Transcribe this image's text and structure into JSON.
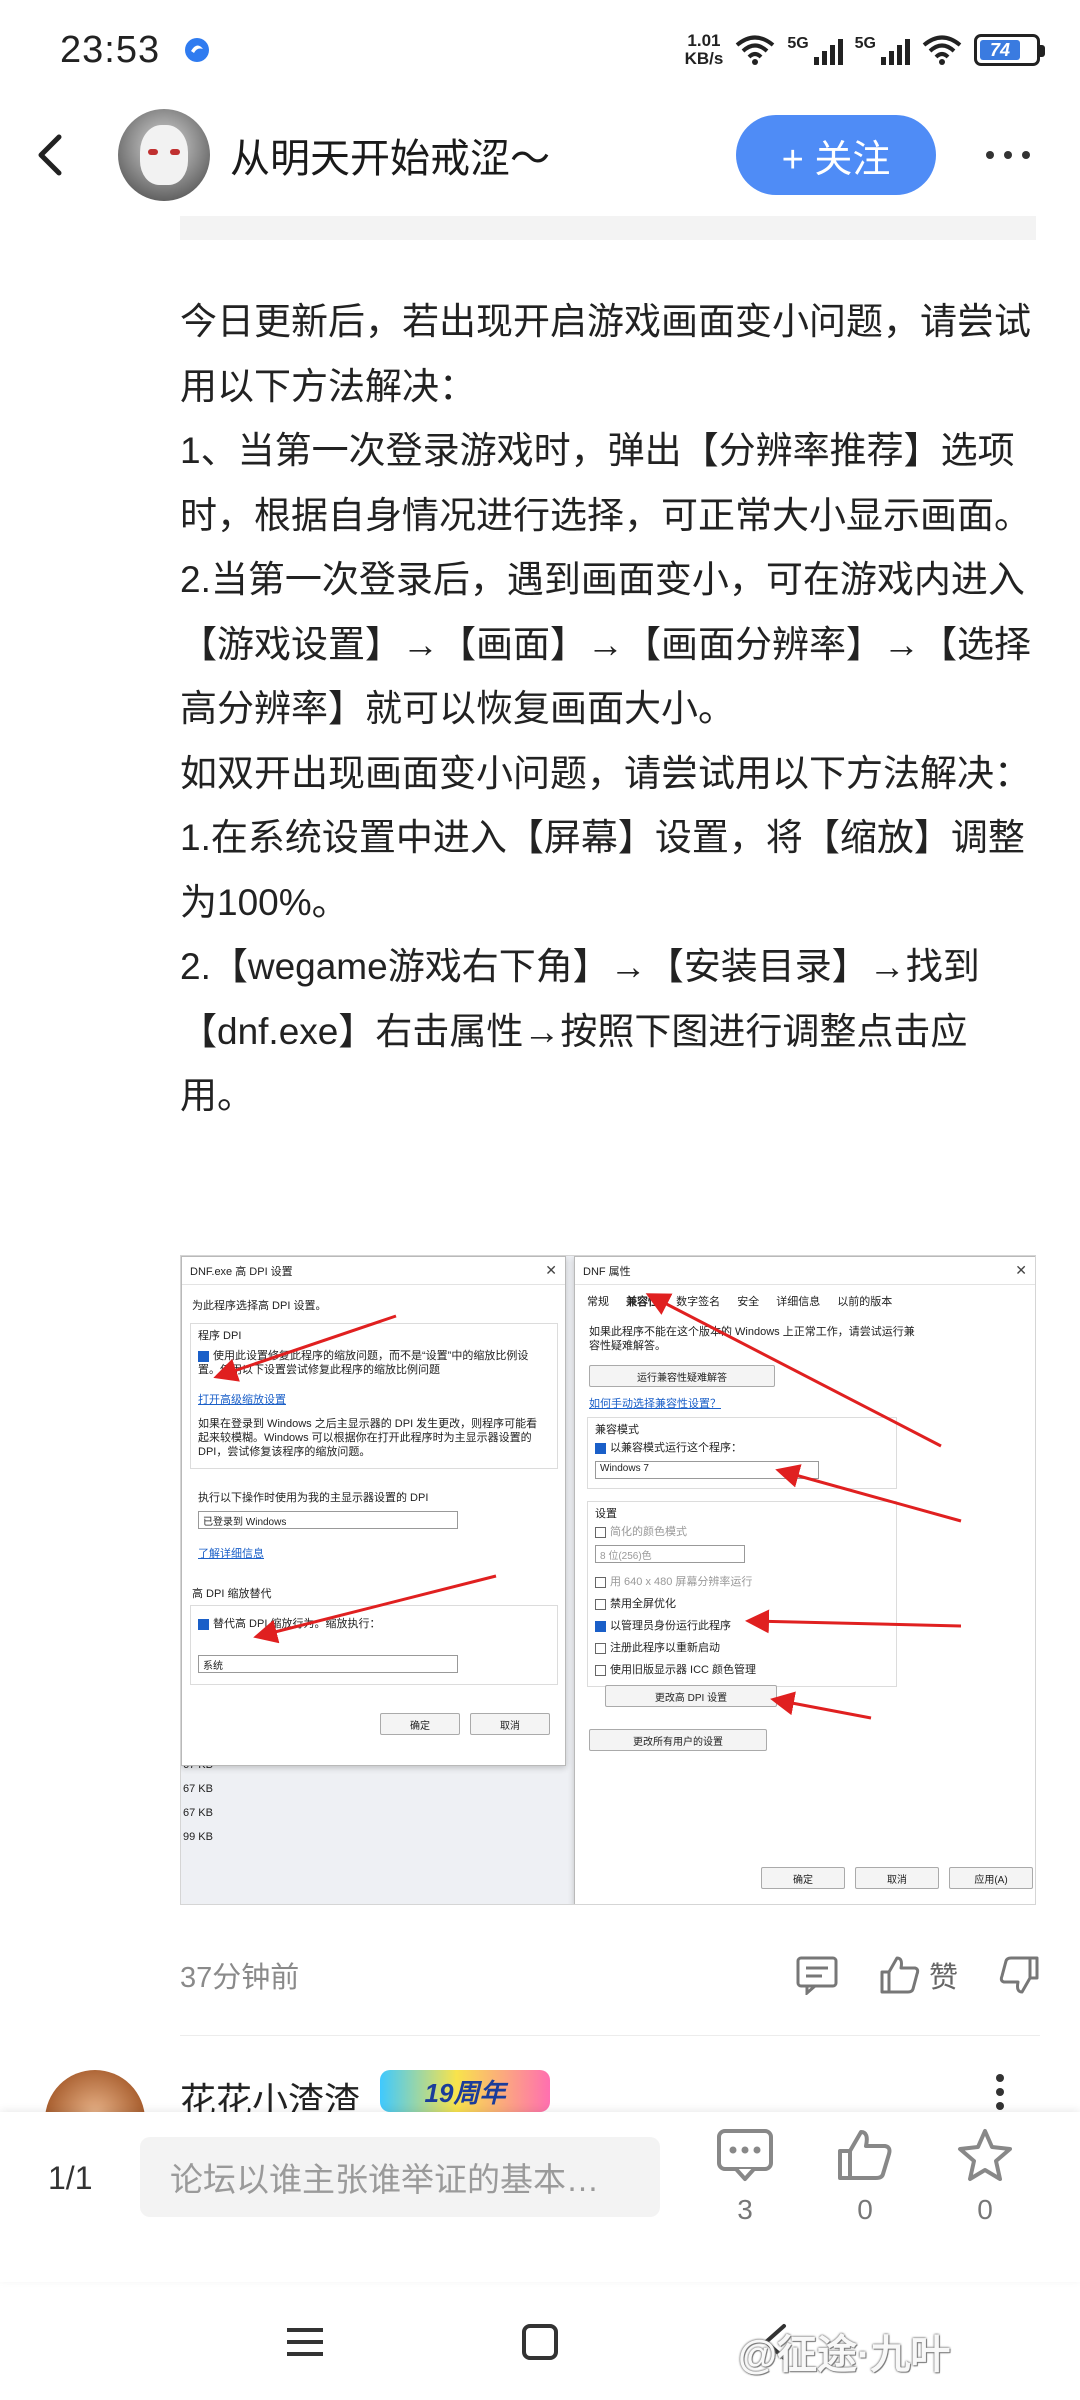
{
  "status_bar": {
    "time": "23:53",
    "net_speed_value": "1.01",
    "net_speed_unit": "KB/s",
    "sim1_label": "5G",
    "sim2_label": "5G",
    "battery": "74"
  },
  "header": {
    "author_name": "从明天开始戒涩～",
    "follow_label": "+ 关注"
  },
  "article": {
    "paragraphs": [
      "今日更新后，若出现开启游戏画面变小问题，请尝试用以下方法解决：",
      "1、当第一次登录游戏时，弹出【分辨率推荐】选项时，根据自身情况进行选择，可正常大小显示画面。",
      "2.当第一次登录后，遇到画面变小，可在游戏内进入【游戏设置】→【画面】→【画面分辨率】→【选择高分辨率】就可以恢复画面大小。",
      "如双开出现画面变小问题，请尝试用以下方法解决：",
      "1.在系统设置中进入【屏幕】设置，将【缩放】调整为100%。",
      "2.【wegame游戏右下角】→【安装目录】→找到【dnf.exe】右击属性→按照下图进行调整点击应用。"
    ]
  },
  "screenshot": {
    "dpi_dialog": {
      "title": "DNF.exe 高 DPI 设置",
      "intro": "为此程序选择高 DPI 设置。",
      "section1": "程序 DPI",
      "check1": "使用此设置修复此程序的缩放问题，而不是“设置”中的缩放比例设置。使用以下设置尝试修复此程序的缩放比例问题",
      "link1": "打开高级缩放设置",
      "desc": "如果在登录到 Windows 之后主显示器的 DPI 发生更改，则程序可能看起来较模糊。Windows 可以根据你在打开此程序时为主显示器设置的 DPI，尝试修复该程序的缩放问题。",
      "exec_label": "执行以下操作时使用为我的主显示器设置的 DPI",
      "exec_value": "已登录到 Windows",
      "link2": "了解详细信息",
      "section2": "高 DPI 缩放替代",
      "check2": "替代高 DPI 缩放行为。缩放执行：",
      "scale_value": "系统",
      "ok": "确定",
      "cancel": "取消"
    },
    "props_dialog": {
      "title": "DNF 属性",
      "tabs": [
        "常规",
        "兼容性",
        "数字签名",
        "安全",
        "详细信息",
        "以前的版本"
      ],
      "intro": "如果此程序不能在这个版本的 Windows 上正常工作，请尝试运行兼容性疑难解答。",
      "troubleshoot_btn": "运行兼容性疑难解答",
      "manual_link": "如何手动选择兼容性设置？",
      "compat_group": "兼容模式",
      "compat_check": "以兼容模式运行这个程序：",
      "compat_value": "Windows 7",
      "settings_group": "设置",
      "reduced_color": "简化的颜色模式",
      "color_value": "8 位(256)色",
      "res_640": "用 640 x 480 屏幕分辨率运行",
      "fullscreen_opt": "禁用全屏优化",
      "run_admin": "以管理员身份运行此程序",
      "register_restart": "注册此程序以重新启动",
      "legacy_icc": "使用旧版显示器 ICC 颜色管理",
      "change_dpi_btn": "更改高 DPI 设置",
      "all_users_btn": "更改所有用户的设置",
      "ok": "确定",
      "cancel": "取消",
      "apply": "应用(A)"
    },
    "side_sizes": [
      "67 KB",
      "67 KB",
      "67 KB",
      "99 KB"
    ]
  },
  "meta": {
    "time_ago": "37分钟前",
    "like_label": "赞"
  },
  "next_comment": {
    "name": "花花小渣渣",
    "badge": "19周年"
  },
  "bottom_bar": {
    "page_indicator": "1/1",
    "reply_placeholder": "论坛以谁主张谁举证的基本…",
    "comment_count": "3",
    "like_count": "0",
    "star_count": "0"
  },
  "watermark": "@征途·九叶",
  "colors": {
    "accent": "#4f8cf6",
    "arrow_red": "#e02020"
  }
}
